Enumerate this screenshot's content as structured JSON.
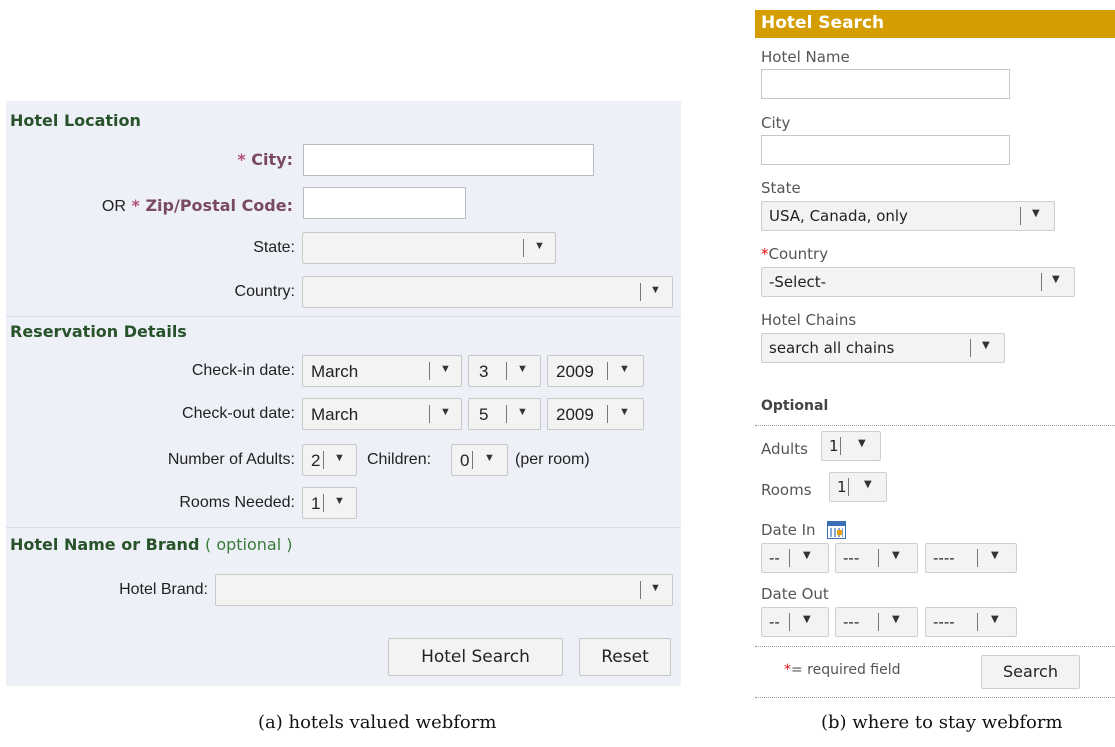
{
  "panel_a": {
    "sections": {
      "location": "Hotel Location",
      "reservation": "Reservation Details",
      "hotel_name": "Hotel Name or Brand",
      "hotel_name_optional": "( optional )"
    },
    "fields": {
      "city_label": "City:",
      "zip_or": "OR",
      "zip_label": "Zip/Postal Code:",
      "required_mark": "*",
      "state_label": "State:",
      "country_label": "Country:",
      "checkin_label": "Check-in date:",
      "checkout_label": "Check-out date:",
      "adults_label": "Number of Adults:",
      "children_label": "Children:",
      "per_room": "(per room)",
      "rooms_label": "Rooms Needed:",
      "brand_label": "Hotel Brand:"
    },
    "values": {
      "city": "",
      "zip": "",
      "state": "",
      "country": "",
      "checkin_month": "March",
      "checkin_day": "3",
      "checkin_year": "2009",
      "checkout_month": "March",
      "checkout_day": "5",
      "checkout_year": "2009",
      "adults": "2",
      "children": "0",
      "rooms": "1",
      "brand": ""
    },
    "buttons": {
      "search": "Hotel Search",
      "reset": "Reset"
    },
    "caption": "(a)  hotels valued webform"
  },
  "panel_b": {
    "header": "Hotel Search",
    "labels": {
      "hotel_name": "Hotel Name",
      "city": "City",
      "state": "State",
      "country": "Country",
      "chains": "Hotel Chains",
      "optional": "Optional",
      "adults": "Adults",
      "rooms": "Rooms",
      "date_in": "Date In",
      "date_out": "Date Out",
      "required_mark": "*",
      "required_note": "= required field"
    },
    "values": {
      "hotel_name": "",
      "city": "",
      "state": "USA, Canada, only",
      "country": "-Select-",
      "chains": "search all chains",
      "adults": "1",
      "rooms": "1",
      "date_in_day": "--",
      "date_in_month": "---",
      "date_in_year": "----",
      "date_out_day": "--",
      "date_out_month": "---",
      "date_out_year": "----"
    },
    "buttons": {
      "search": "Search"
    },
    "caption": "(b)  where to stay webform"
  },
  "colors": {
    "panel_a_bg": "#eef0f8",
    "panel_a_heading": "#28532a",
    "required_label": "#7a4a63",
    "panel_b_header": "#d49d00",
    "required_star": "#dd1111"
  }
}
